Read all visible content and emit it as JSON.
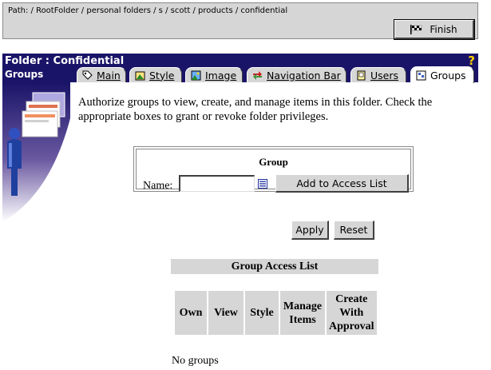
{
  "path": {
    "text": "Path: / RootFolder / personal folders / s / scott / products / confidential"
  },
  "toolbar": {
    "finish_label": "Finish"
  },
  "header": {
    "folder_title": "Folder : Confidential",
    "section": "Groups",
    "help_label": "?"
  },
  "tabs": [
    {
      "label": "Main",
      "icon": "tag-icon",
      "active": false
    },
    {
      "label": "Style",
      "icon": "style-icon",
      "active": false
    },
    {
      "label": "Image",
      "icon": "image-icon",
      "active": false
    },
    {
      "label": "Navigation Bar",
      "icon": "navigation-icon",
      "active": false
    },
    {
      "label": "Users",
      "icon": "users-icon",
      "active": false
    },
    {
      "label": "Groups",
      "icon": "groups-icon",
      "active": true
    }
  ],
  "intro_text": "Authorize groups to view, create, and manage items in this folder. Check the appropriate boxes to grant or revoke folder privileges.",
  "group_form": {
    "title": "Group",
    "name_label": "Name:",
    "name_value": "",
    "add_label": "Add to Access List"
  },
  "actions": {
    "apply_label": "Apply",
    "reset_label": "Reset"
  },
  "access_list": {
    "title": "Group Access List",
    "columns": [
      "Own",
      "View",
      "Style",
      "Manage Items",
      "Create With Approval"
    ],
    "empty_text": "No groups"
  },
  "colors": {
    "header_bg": "#1a1468",
    "panel_gray": "#d6d6d6",
    "help_yellow": "#ffd000"
  }
}
